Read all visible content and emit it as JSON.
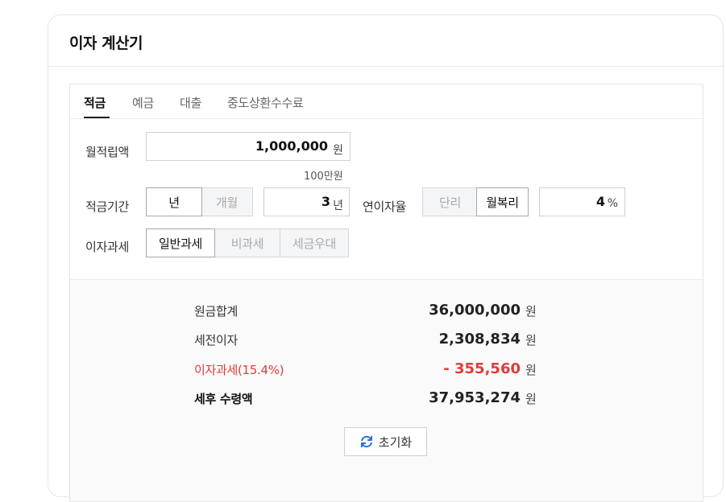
{
  "card": {
    "title": "이자 계산기"
  },
  "tabs": [
    {
      "label": "적금",
      "active": true
    },
    {
      "label": "예금",
      "active": false
    },
    {
      "label": "대출",
      "active": false
    },
    {
      "label": "중도상환수수료",
      "active": false
    }
  ],
  "form": {
    "monthly": {
      "label": "월적립액",
      "value": "1,000,000",
      "unit": "원",
      "hint": "100만원"
    },
    "period": {
      "label": "적금기간",
      "options": [
        "년",
        "개월"
      ],
      "selected": "년",
      "value": "3",
      "unit": "년"
    },
    "rate": {
      "label": "연이자율",
      "options": [
        "단리",
        "월복리"
      ],
      "selected": "월복리",
      "value": "4",
      "unit": "%"
    },
    "tax": {
      "label": "이자과세",
      "options": [
        "일반과세",
        "비과세",
        "세금우대"
      ],
      "selected": "일반과세"
    }
  },
  "results": [
    {
      "label": "원금합계",
      "value": "36,000,000",
      "unit": "원",
      "style": "normal"
    },
    {
      "label": "세전이자",
      "value": "2,308,834",
      "unit": "원",
      "style": "normal"
    },
    {
      "label": "이자과세(15.4%)",
      "value": "- 355,560",
      "unit": "원",
      "style": "red"
    },
    {
      "label": "세후 수령액",
      "value": "37,953,274",
      "unit": "원",
      "style": "bold"
    }
  ],
  "reset": {
    "label": "초기화",
    "icon": "refresh-icon"
  },
  "colors": {
    "accent_red": "#e03b3b",
    "reset_icon": "#2b6fd6"
  }
}
